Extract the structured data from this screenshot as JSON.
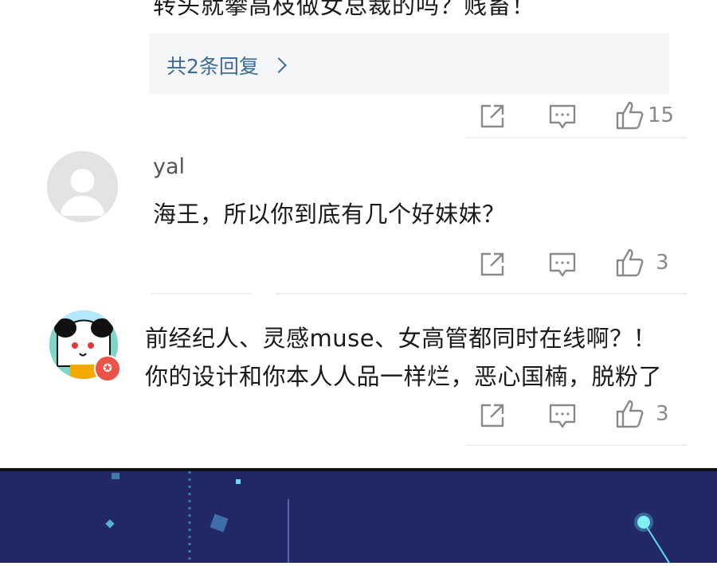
{
  "thread1": {
    "partial_text": "转头就攀高枝做女总裁的吗？贱畜！",
    "reply_link": "共2条回复",
    "like_count": "15"
  },
  "comment_yal": {
    "username": "yal",
    "text": "海王，所以你到底有几个好妹妹？",
    "like_count": "3"
  },
  "comment_muse": {
    "line1": "前经纪人、灵感muse、女高管都同时在线啊？！",
    "line2": "你的设计和你本人人品一样烂，恶心国楠，脱粉了",
    "like_count": "3"
  },
  "icons": {
    "share": "share-icon",
    "comment": "comment-icon",
    "like": "thumbs-up-icon",
    "badge": "star-badge-icon"
  },
  "colors": {
    "link": "#3d6a9a",
    "muted": "#8a8a8a",
    "dark_banner": "#222866",
    "accent_cyan": "#5fe0ea"
  }
}
